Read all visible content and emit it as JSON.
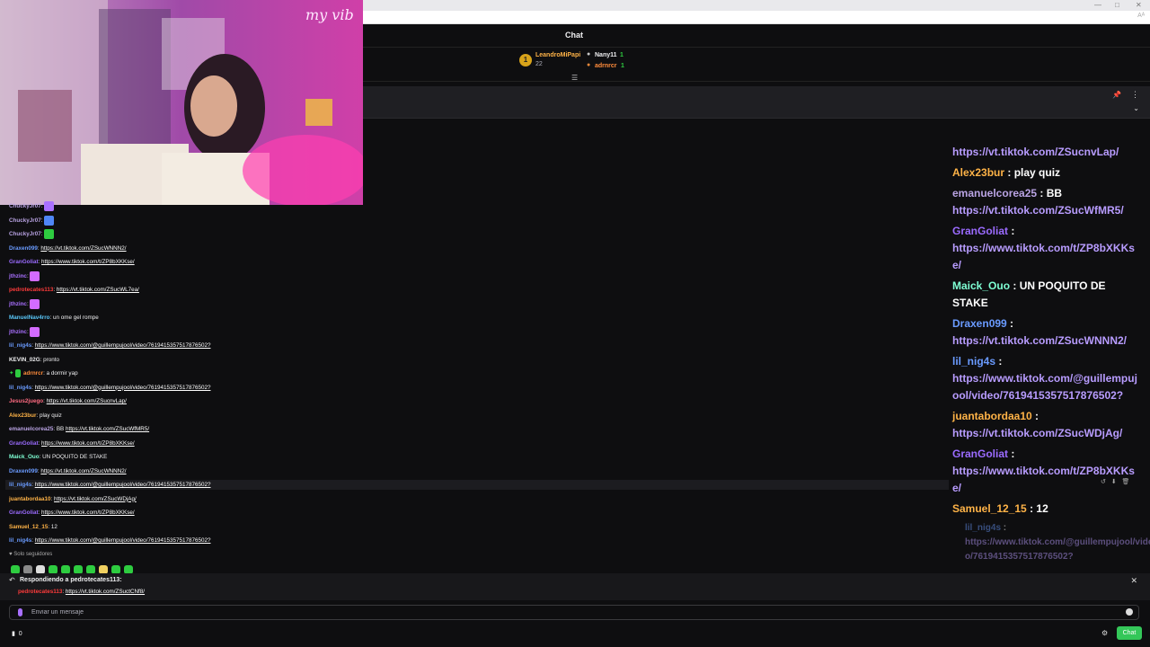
{
  "window": {
    "read_label": "Aᴬ"
  },
  "webcam": {
    "neon_text": "my vib"
  },
  "header": {
    "title": "Chat"
  },
  "leaderboard": {
    "first": {
      "rank": "1",
      "name": "LeandroMiPapi",
      "count": "22"
    },
    "second": {
      "name": "Nany11",
      "count": "1"
    },
    "third": {
      "name": "adrnrcr",
      "count": "1"
    },
    "sort_icon": "filter-icon"
  },
  "small_chat": [
    {
      "user": "ChuckyJr07",
      "color": "#b9a3e3",
      "sep": ":",
      "emote": "#a970ff"
    },
    {
      "user": "ChuckyJr07",
      "color": "#b9a3e3",
      "sep": ":",
      "emote": "#4f86f7"
    },
    {
      "user": "ChuckyJr07",
      "color": "#b9a3e3",
      "sep": ":",
      "emote": "#2ecc40"
    },
    {
      "user": "Draxen099",
      "color": "#6a9bff",
      "sep": ":",
      "link": "https://vt.tiktok.com/ZSucWNNN2/"
    },
    {
      "user": "GranGoliat",
      "color": "#9b6bff",
      "sep": ":",
      "link": "https://www.tiktok.com/t/ZP8bXKKse/"
    },
    {
      "user": "jthzinc",
      "color": "#a970ff",
      "sep": ":",
      "emote": "#d36bff"
    },
    {
      "user": "pedrotecates113",
      "color": "#ff3b3b",
      "sep": ":",
      "link": "https://vt.tiktok.com/ZSucWL7ea/"
    },
    {
      "user": "jthzinc",
      "color": "#a970ff",
      "sep": ":",
      "emote": "#d36bff"
    },
    {
      "user": "ManuelNav4rro",
      "color": "#5ac8fa",
      "sep": ":",
      "text": "un ome gel rompe"
    },
    {
      "user": "jthzinc",
      "color": "#a970ff",
      "sep": ":",
      "emote": "#d36bff"
    },
    {
      "user": "lil_nig4s",
      "color": "#6a9bff",
      "sep": ":",
      "link": "https://www.tiktok.com/@guillempujool/video/7619415357517876502?"
    },
    {
      "user": "KEVIN_02G",
      "color": "#efeff1",
      "sep": ":",
      "text": "pronto"
    },
    {
      "user": "adrnrcr",
      "color": "#ff8c3b",
      "sep": ":",
      "text": "a dormir yap",
      "badges": true
    },
    {
      "user": "lil_nig4s",
      "color": "#6a9bff",
      "sep": ":",
      "link": "https://www.tiktok.com/@guillempujool/video/7619415357517876502?"
    },
    {
      "user": "Jesus2juego",
      "color": "#ff6b81",
      "sep": ":",
      "link": "https://vt.tiktok.com/ZSucnvLap/"
    },
    {
      "user": "Alex23bur",
      "color": "#ffb347",
      "sep": ":",
      "text": "play quiz"
    },
    {
      "user": "emanuelcorea25",
      "color": "#b9a3e3",
      "sep": ":",
      "text": "BB",
      "link": "https://vt.tiktok.com/ZSucWfMR5/"
    },
    {
      "user": "GranGoliat",
      "color": "#9b6bff",
      "sep": ":",
      "link": "https://www.tiktok.com/t/ZP8bXKKse/"
    },
    {
      "user": "Maick_Ouo",
      "color": "#7fffd4",
      "sep": ":",
      "text": "UN POQUITO DE STAKE"
    },
    {
      "user": "Draxen099",
      "color": "#6a9bff",
      "sep": ":",
      "link": "https://vt.tiktok.com/ZSucWNNN2/"
    },
    {
      "user": "lil_nig4s",
      "color": "#6a9bff",
      "sep": ":",
      "link": "https://www.tiktok.com/@guillempujool/video/7619415357517876502?",
      "highlight": true
    },
    {
      "user": "juantabordaa10",
      "color": "#ffb347",
      "sep": ":",
      "link": "https://vt.tiktok.com/ZSucWDjAg/"
    },
    {
      "user": "GranGoliat",
      "color": "#9b6bff",
      "sep": ":",
      "link": "https://www.tiktok.com/t/ZP8bXKKse/"
    },
    {
      "user": "Samuel_12_15",
      "color": "#ffb347",
      "sep": ":",
      "text": "12"
    },
    {
      "user": "lil_nig4s",
      "color": "#6a9bff",
      "sep": ":",
      "link": "https://www.tiktok.com/@guillempujool/video/7619415357517876502?"
    }
  ],
  "followers_only": "Solo seguidores",
  "big_chat": [
    {
      "link_only": "https://vt.tiktok.com/ZSucnvLap/"
    },
    {
      "user": "Alex23bur",
      "color": "#ffb347",
      "text": "play quiz"
    },
    {
      "user": "emanuelcorea25",
      "color": "#b9a3e3",
      "text": "BB",
      "link": "https://vt.tiktok.com/ZSucWfMR5/"
    },
    {
      "user": "GranGoliat",
      "color": "#9b6bff",
      "link": "https://www.tiktok.com/t/ZP8bXKKse/"
    },
    {
      "user": "Maick_Ouo",
      "color": "#7fffd4",
      "text": "UN POQUITO DE STAKE"
    },
    {
      "user": "Draxen099",
      "color": "#6a9bff",
      "link": "https://vt.tiktok.com/ZSucWNNN2/"
    },
    {
      "user": "lil_nig4s",
      "color": "#6a9bff",
      "link": "https://www.tiktok.com/@guillempujool/video/7619415357517876502?"
    },
    {
      "user": "juantabordaa10",
      "color": "#ffb347",
      "link": "https://vt.tiktok.com/ZSucWDjAg/"
    },
    {
      "user": "GranGoliat",
      "color": "#9b6bff",
      "link": "https://www.tiktok.com/t/ZP8bXKKse/"
    },
    {
      "user": "Samuel_12_15",
      "color": "#ffb347",
      "text": "12"
    },
    {
      "user": "lil_nig4s",
      "color": "#6a9bff",
      "link": "https://www.tiktok.com/@guillempujool/video/7619415357517876502?",
      "faded": true
    }
  ],
  "reply": {
    "heading": "Respondiendo a pedrotecates113:",
    "quote_user": "pedrotecates113",
    "quote_link": "https://vt.tiktok.com/ZSuctCNf8/"
  },
  "input": {
    "placeholder": "Enviar un mensaje"
  },
  "bottom": {
    "points": "0",
    "chat_button": "Chat"
  }
}
